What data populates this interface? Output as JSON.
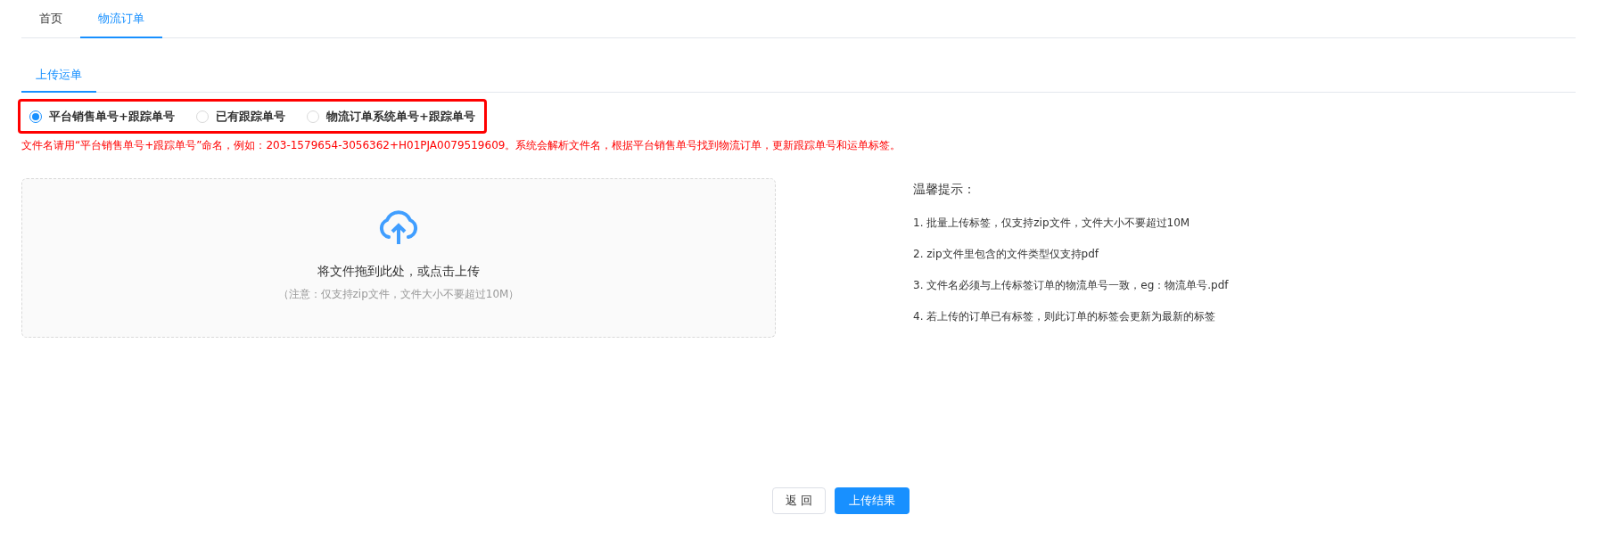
{
  "tabs": [
    {
      "label": "首页",
      "selected": false
    },
    {
      "label": "物流订单",
      "selected": true
    }
  ],
  "sub_tabs": [
    {
      "label": "上传运单",
      "selected": true
    }
  ],
  "radio_group": {
    "highlighted": true,
    "options": [
      {
        "label": "平台销售单号+跟踪单号",
        "selected": true
      },
      {
        "label": "已有跟踪单号",
        "selected": false
      },
      {
        "label": "物流订单系统单号+跟踪单号",
        "selected": false
      }
    ]
  },
  "naming_hint": "文件名请用“平台销售单号+跟踪单号”命名，例如：203-1579654-3056362+H01PJA0079519609。系统会解析文件名，根据平台销售单号找到物流订单，更新跟踪单号和运单标签。",
  "upload": {
    "text": "将文件拖到此处，或点击上传",
    "note": "（注意：仅支持zip文件，文件大小不要超过10M）"
  },
  "tips": {
    "title": "温馨提示：",
    "items": [
      "1. 批量上传标签，仅支持zip文件，文件大小不要超过10M",
      "2. zip文件里包含的文件类型仅支持pdf",
      "3. 文件名必须与上传标签订单的物流单号一致，eg：物流单号.pdf",
      "4. 若上传的订单已有标签，则此订单的标签会更新为最新的标签"
    ]
  },
  "buttons": [
    {
      "label": "返 回",
      "kind": "default"
    },
    {
      "label": "上传结果",
      "kind": "primary"
    }
  ]
}
